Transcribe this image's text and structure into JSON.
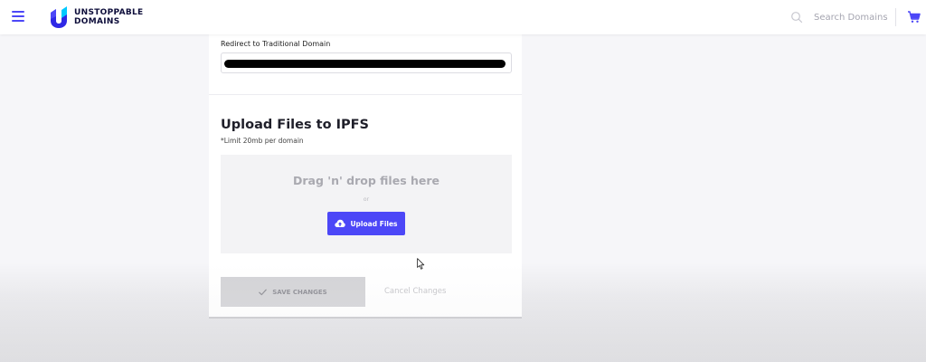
{
  "header": {
    "logo_line1": "UNSTOPPABLE",
    "logo_line2": "DOMAINS",
    "search_placeholder": "Search Domains",
    "menu_icon": "hamburger-menu-icon",
    "cart_icon": "cart-icon",
    "accent_color": "#4c47f7"
  },
  "redirect": {
    "label": "Redirect to Traditional Domain",
    "value_redacted": true
  },
  "upload": {
    "title": "Upload Files to IPFS",
    "limit": "*Limit 20mb per domain",
    "drop_text": "Drag 'n' drop files here",
    "or_text": "or",
    "button_label": "Upload Files",
    "button_icon": "cloud-upload-icon"
  },
  "actions": {
    "save_label": "SAVE CHANGES",
    "save_icon": "check-icon",
    "cancel_label": "Cancel Changes"
  }
}
